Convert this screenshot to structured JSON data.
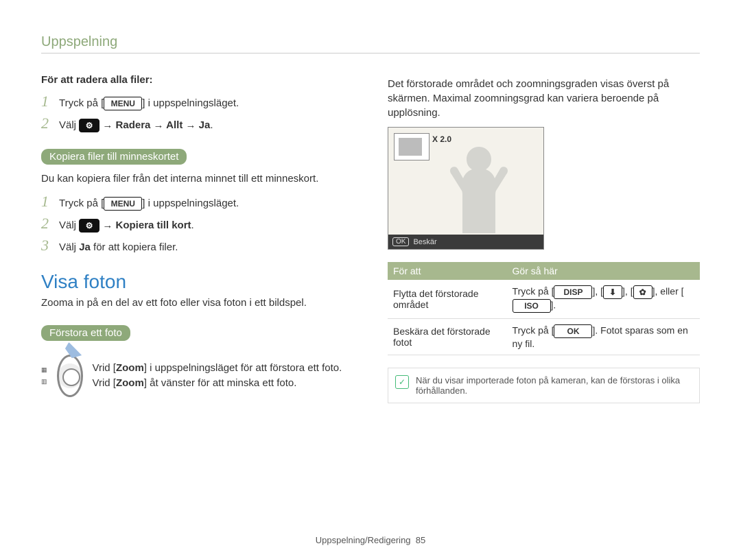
{
  "header": {
    "title": "Uppspelning"
  },
  "left": {
    "delete_heading": "För att radera alla filer:",
    "steps1": [
      {
        "pre": "Tryck på [",
        "badge": "MENU",
        "post": "] i uppspelningsläget."
      },
      {
        "pre": "Välj ",
        "icon": "settings-icon",
        "postbold": " → Radera → Allt → Ja",
        "post": "."
      }
    ],
    "copy_pill": "Kopiera filer till minneskortet",
    "copy_desc": "Du kan kopiera filer från det interna minnet till ett minneskort.",
    "steps2": [
      {
        "pre": "Tryck på [",
        "badge": "MENU",
        "post": "] i uppspelningsläget."
      },
      {
        "pre": "Välj ",
        "icon": "settings-icon",
        "postbold": " → Kopiera till kort",
        "post": "."
      },
      {
        "pre": "Välj ",
        "bold": "Ja",
        "post": " för att kopiera filer."
      }
    ],
    "visa_heading": "Visa foton",
    "visa_desc": "Zooma in på en del av ett foto eller visa foton i ett bildspel.",
    "enlarge_pill": "Förstora ett foto",
    "zoom_text_a": "Vrid [",
    "zoom_text_b": "] i uppspelningsläget för att förstora ett foto. Vrid [",
    "zoom_text_c": "] åt vänster för att minska ett foto.",
    "zoom_word": "Zoom"
  },
  "right": {
    "intro": "Det förstorade området och zoomningsgraden visas överst på skärmen. Maximal zoomningsgrad kan variera beroende på upplösning.",
    "screen": {
      "zoom_label": "X 2.0",
      "ok": "OK",
      "crop": "Beskär"
    },
    "table": {
      "h1": "För att",
      "h2": "Gör så här",
      "r1c1": "Flytta det förstorade området",
      "r1_pre": "Tryck på [",
      "r1_b1": "DISP",
      "r1_mid1": "], [",
      "r1_b2": "⬇",
      "r1_mid2": "], [",
      "r1_b3": "✿",
      "r1_mid3": "], eller [",
      "r1_b4": "ISO",
      "r1_post": "].",
      "r2c1": "Beskära det förstorade fotot",
      "r2_pre": "Tryck på [",
      "r2_b1": "OK",
      "r2_post": "]. Fotot sparas som en ny fil."
    },
    "note": {
      "symbol": "✓",
      "text": "När du visar importerade foton på kameran, kan de förstoras i olika förhållanden."
    }
  },
  "footer": {
    "text": "Uppspelning/Redigering",
    "page": "85"
  }
}
